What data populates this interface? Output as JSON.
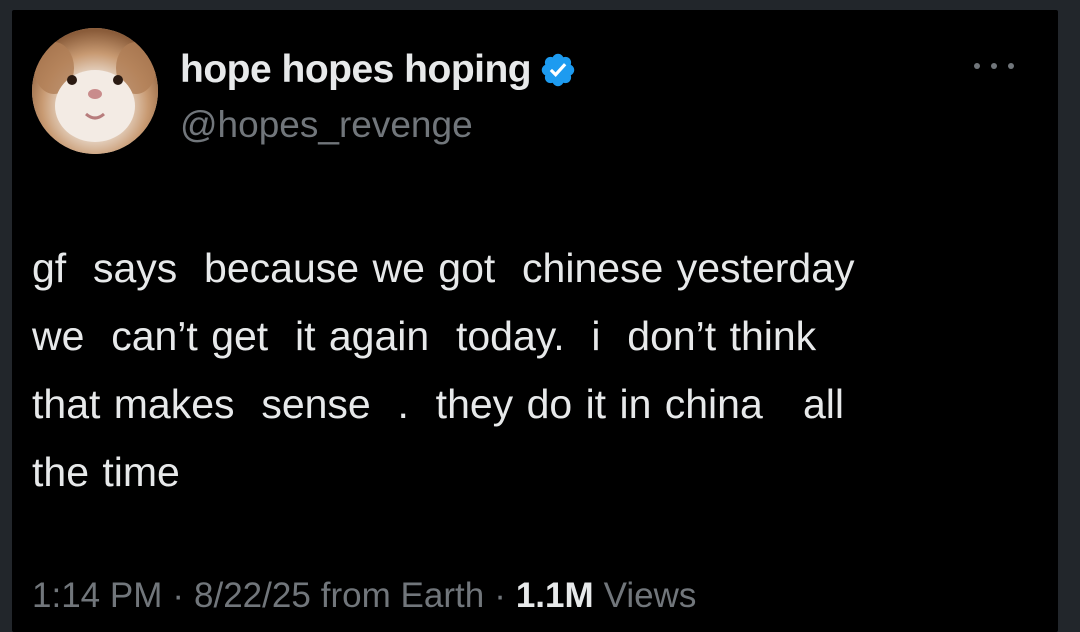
{
  "author": {
    "display_name": "hope hopes hoping",
    "handle": "@hopes_revenge",
    "verified": true,
    "avatar_icon": "hamster-avatar"
  },
  "tweet": {
    "text": "gf  says  because we got  chinese yesterday\nwe  can’t get  it again  today.  i  don’t think\nthat makes  sense  .  they do it in china   all\nthe time"
  },
  "meta": {
    "time": "1:14 PM",
    "date": "8/22/25",
    "source": "from Earth",
    "separator": "·",
    "views_count": "1.1M",
    "views_label": "Views"
  },
  "colors": {
    "background": "#000000",
    "primary_text": "#e7e9ea",
    "secondary_text": "#71767b",
    "verified_badge": "#1d9bf0"
  },
  "icons": {
    "verified": "verified-badge-icon",
    "more": "more-options-icon"
  }
}
